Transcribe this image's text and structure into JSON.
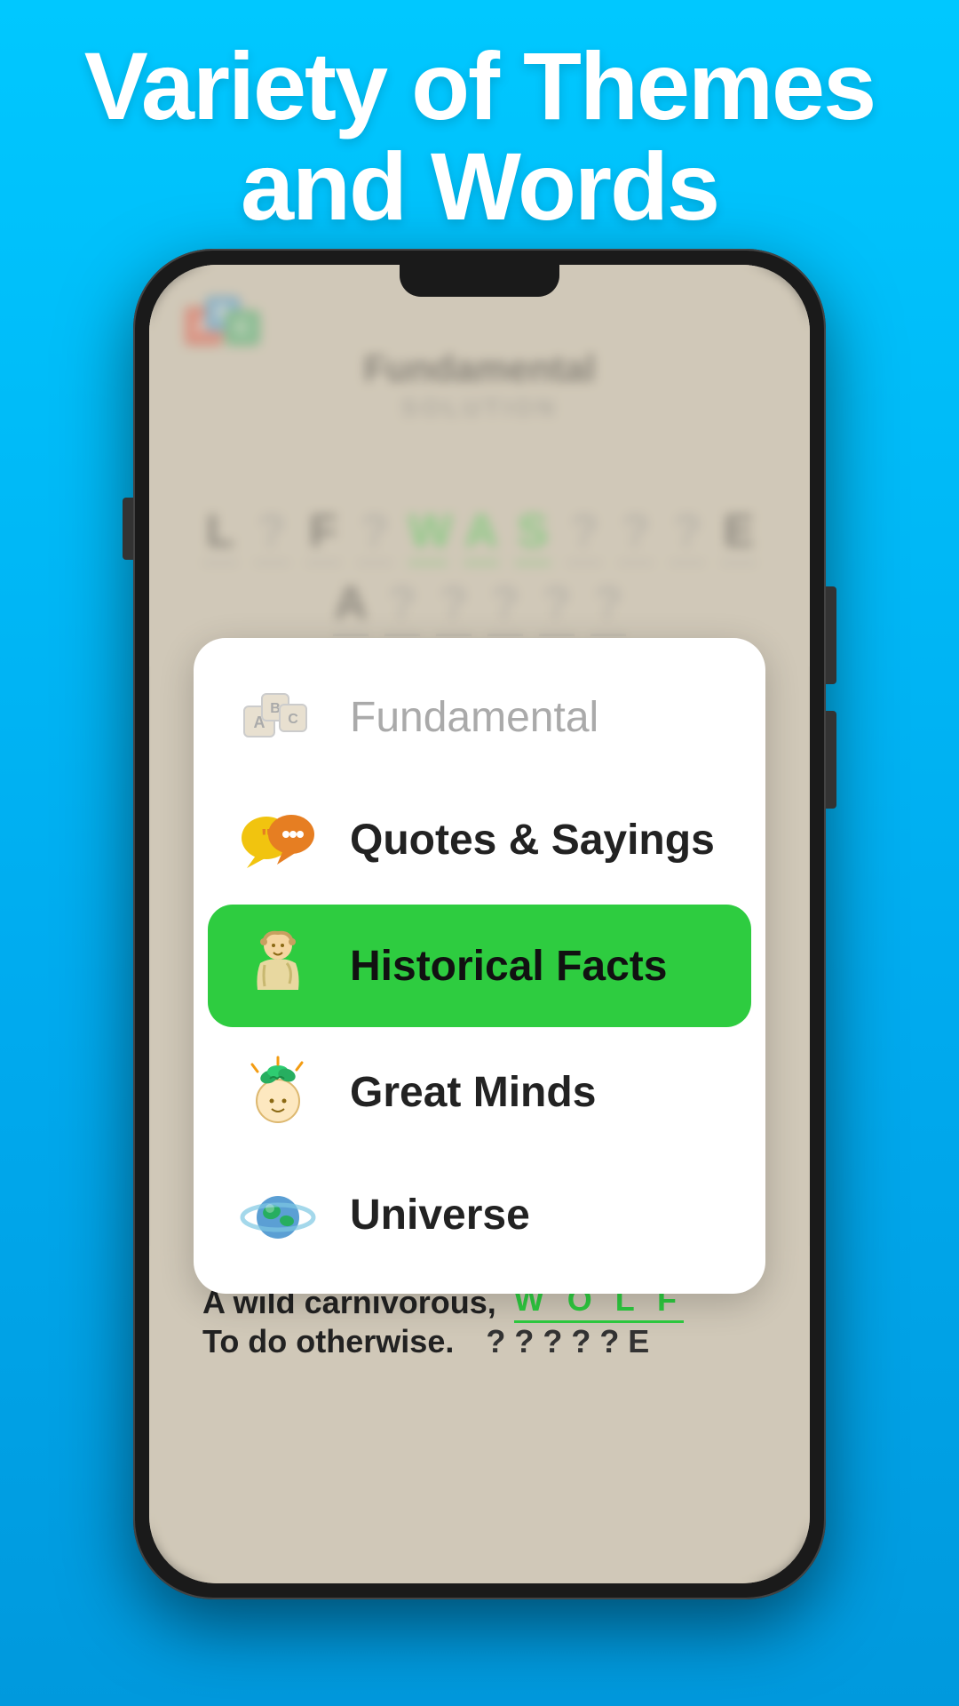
{
  "header": {
    "line1": "Variety of Themes",
    "line2": "and Words"
  },
  "phone": {
    "app_title": "Fundamental",
    "app_subtitle": "SOLUTION",
    "puzzle_row1": [
      "L",
      "?",
      "F",
      "?",
      "W",
      "A",
      "S",
      "?",
      "?",
      "?",
      "E"
    ],
    "puzzle_row2": [
      "A",
      "?",
      "?",
      "?",
      "?",
      "?"
    ],
    "clue1_text": "A wild carnivorous,",
    "clue1_answer": "W O L F",
    "clue2_text": "To do otherwise.",
    "clue2_answer": "? ? ? ? ? E"
  },
  "menu": {
    "items": [
      {
        "id": "fundamental",
        "label": "Fundamental",
        "icon": "blocks-icon",
        "active": false,
        "inactive": true
      },
      {
        "id": "quotes",
        "label": "Quotes & Sayings",
        "icon": "quotes-icon",
        "active": false,
        "inactive": false
      },
      {
        "id": "historical",
        "label": "Historical Facts",
        "icon": "historical-icon",
        "active": true,
        "inactive": false
      },
      {
        "id": "great-minds",
        "label": "Great Minds",
        "icon": "brain-icon",
        "active": false,
        "inactive": false
      },
      {
        "id": "universe",
        "label": "Universe",
        "icon": "planet-icon",
        "active": false,
        "inactive": false
      }
    ]
  },
  "colors": {
    "bg": "#00BFFF",
    "active_green": "#2ecc40",
    "text_inactive": "#aaaaaa",
    "text_active": "#111111",
    "white": "#ffffff"
  }
}
